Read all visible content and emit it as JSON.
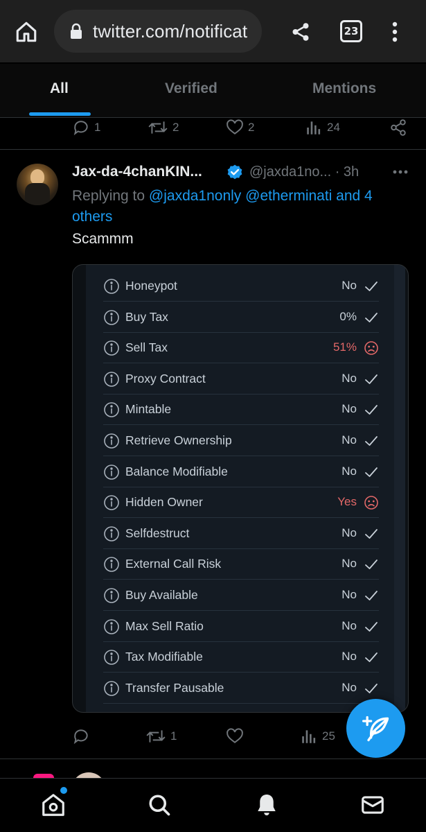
{
  "browser": {
    "url": "twitter.com/notificat",
    "tab_count": "23",
    "icons": [
      "home-icon",
      "lock-icon",
      "share-icon",
      "tabs-icon",
      "more-vert-icon"
    ]
  },
  "tabs": [
    {
      "label": "All",
      "active": true
    },
    {
      "label": "Verified",
      "active": false
    },
    {
      "label": "Mentions",
      "active": false
    }
  ],
  "prev_tweet_actions": {
    "replies": "1",
    "retweets": "2",
    "likes": "2",
    "views": "24"
  },
  "tweet": {
    "display_name": "Jax-da-4chanKIN...",
    "handle_time": "@jaxda1no... · 3h",
    "reply_prefix": "Replying to",
    "reply_mentions": "@jaxda1nonly @etherminati and 4 others",
    "text": "Scammm",
    "actions": {
      "replies": "",
      "retweets": "1",
      "likes": "",
      "views": "25"
    }
  },
  "token_checks": [
    {
      "label": "Honeypot",
      "value": "No",
      "status": "ok"
    },
    {
      "label": "Buy Tax",
      "value": "0%",
      "status": "ok"
    },
    {
      "label": "Sell Tax",
      "value": "51%",
      "status": "bad"
    },
    {
      "label": "Proxy Contract",
      "value": "No",
      "status": "ok"
    },
    {
      "label": "Mintable",
      "value": "No",
      "status": "ok"
    },
    {
      "label": "Retrieve Ownership",
      "value": "No",
      "status": "ok"
    },
    {
      "label": "Balance Modifiable",
      "value": "No",
      "status": "ok"
    },
    {
      "label": "Hidden Owner",
      "value": "Yes",
      "status": "bad"
    },
    {
      "label": "Selfdestruct",
      "value": "No",
      "status": "ok"
    },
    {
      "label": "External Call Risk",
      "value": "No",
      "status": "ok"
    },
    {
      "label": "Buy Available",
      "value": "No",
      "status": "ok"
    },
    {
      "label": "Max Sell Ratio",
      "value": "No",
      "status": "ok"
    },
    {
      "label": "Tax Modifiable",
      "value": "No",
      "status": "ok"
    },
    {
      "label": "Transfer Pausable",
      "value": "No",
      "status": "ok"
    }
  ],
  "colors": {
    "accent": "#1d9bf0",
    "muted": "#71767b",
    "bad": "#e36868",
    "background": "#000000"
  },
  "bottom_nav": {
    "icons": [
      "home-icon",
      "search-icon",
      "bell-icon",
      "mail-icon"
    ]
  }
}
